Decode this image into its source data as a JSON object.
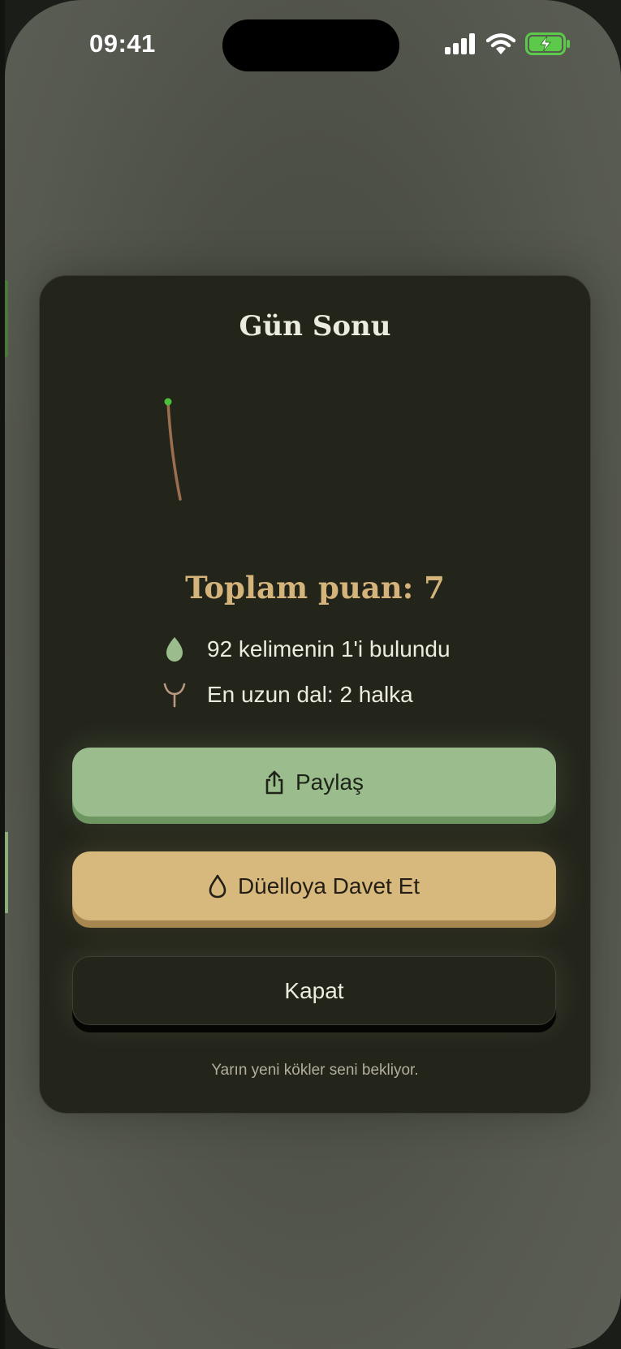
{
  "status_bar": {
    "time": "09:41",
    "icons": [
      "cellular-signal-icon",
      "wifi-icon",
      "battery-charging-icon"
    ]
  },
  "modal": {
    "title": "Gün Sonu",
    "score_text": "Toplam puan: 7",
    "stats": [
      {
        "icon": "leaf-icon",
        "text": "92 kelimenin 1'i bulundu"
      },
      {
        "icon": "branch-icon",
        "text": "En uzun dal: 2 halka"
      }
    ],
    "buttons": {
      "share_label": "Paylaş",
      "duel_label": "Düelloya Davet Et",
      "close_label": "Kapat"
    },
    "footer_text": "Yarın yeni kökler seni bekliyor."
  },
  "colors": {
    "modal_bg": "#23251b",
    "score": "#d4b47a",
    "share_button": "#9bbd8d",
    "duel_button": "#d8b97d",
    "leaf": "#9bbd8d",
    "root": "#9a6e4e",
    "battery": "#5cc94a"
  }
}
